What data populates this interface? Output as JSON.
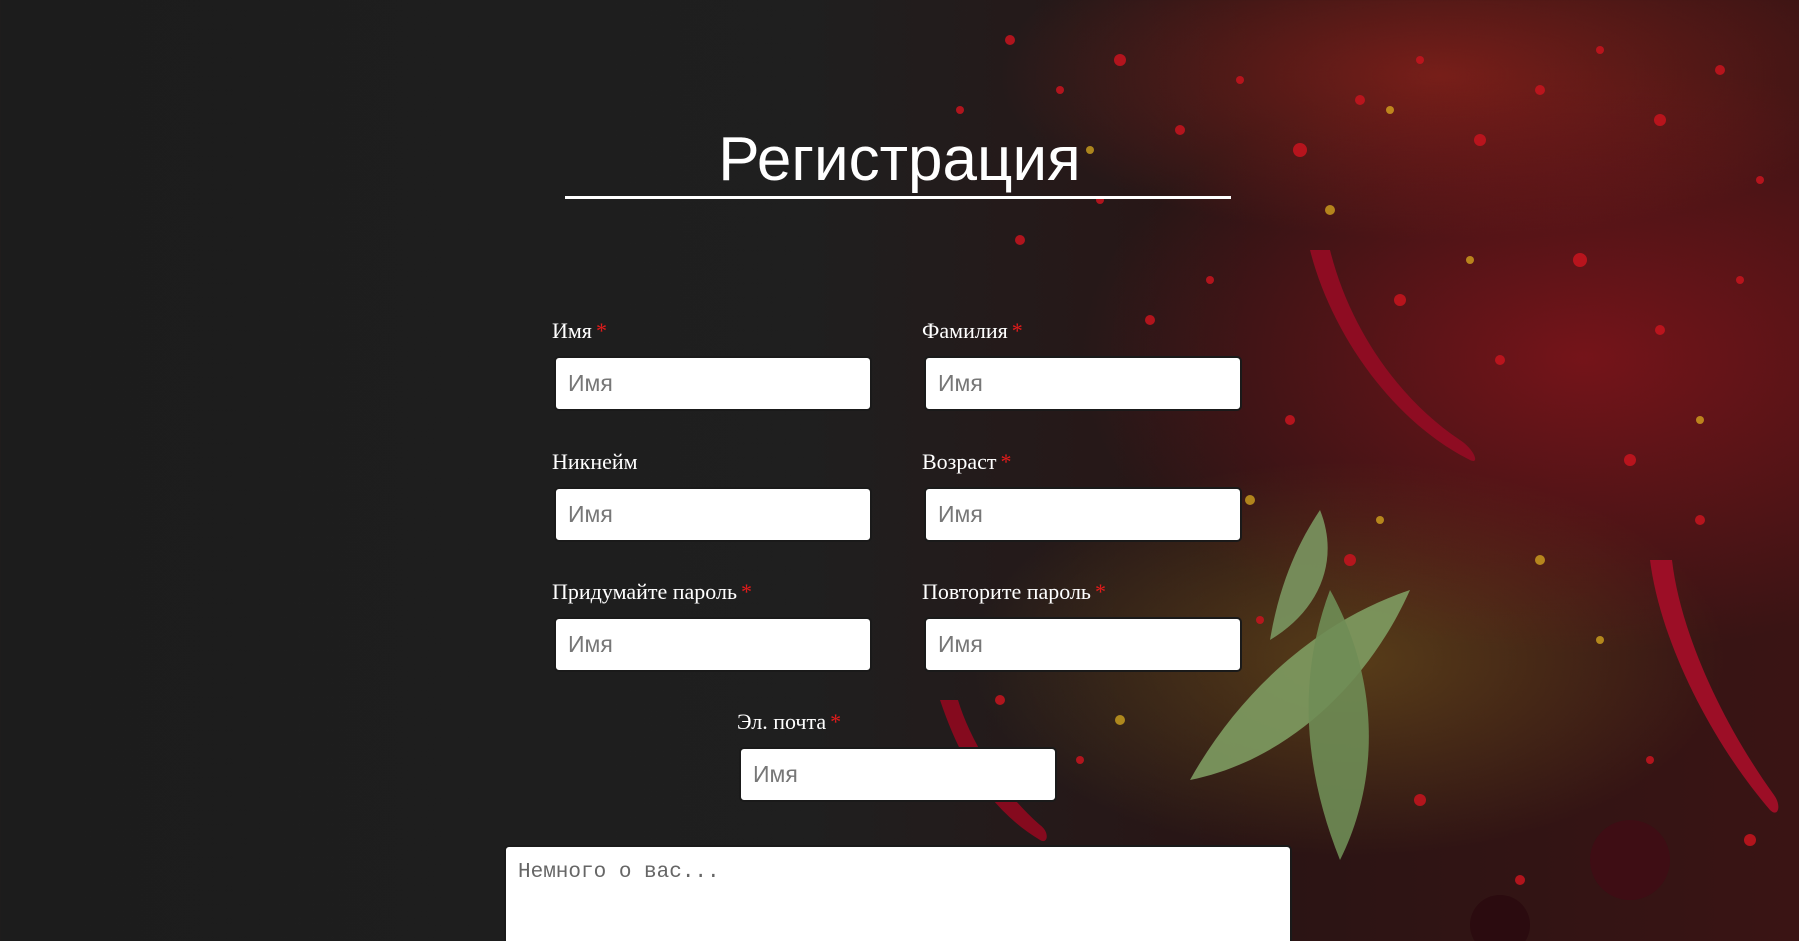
{
  "page": {
    "title": "Регистрация"
  },
  "form": {
    "fields": [
      {
        "id": "first-name",
        "label": "Имя",
        "required": true,
        "placeholder": "Имя",
        "value": ""
      },
      {
        "id": "last-name",
        "label": "Фамилия",
        "required": true,
        "placeholder": "Имя",
        "value": ""
      },
      {
        "id": "nickname",
        "label": "Никнейм",
        "required": false,
        "placeholder": "Имя",
        "value": ""
      },
      {
        "id": "age",
        "label": "Возраст",
        "required": true,
        "placeholder": "Имя",
        "value": ""
      },
      {
        "id": "password",
        "label": "Придумайте пароль",
        "required": true,
        "placeholder": "Имя",
        "value": ""
      },
      {
        "id": "password-repeat",
        "label": "Повторите пароль",
        "required": true,
        "placeholder": "Имя",
        "value": ""
      },
      {
        "id": "email",
        "label": "Эл. почта",
        "required": true,
        "placeholder": "Имя",
        "value": ""
      }
    ],
    "required_marker": "*",
    "about": {
      "placeholder": "Немного о вас...",
      "value": ""
    }
  },
  "colors": {
    "background": "#1c1c1c",
    "text": "#ffffff",
    "required": "#e21b1b",
    "input_bg": "#ffffff"
  }
}
